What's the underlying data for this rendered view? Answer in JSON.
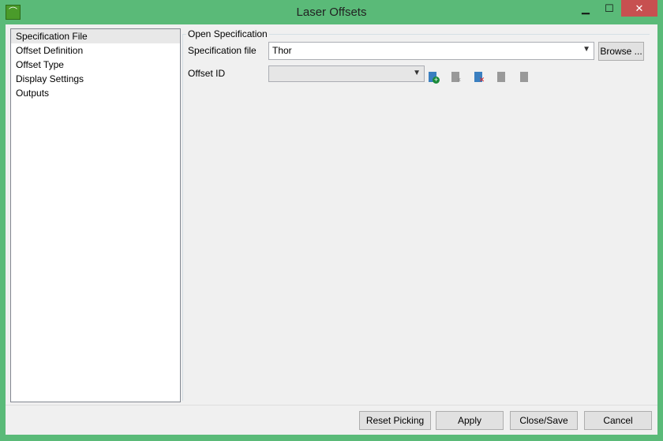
{
  "window": {
    "title": "Laser Offsets",
    "minimize": "▁",
    "maximize": "☐",
    "close": "✕"
  },
  "tree": [
    "Specification File",
    "Offset Definition",
    "Offset Type",
    "Display Settings",
    "Outputs"
  ],
  "group": {
    "title": "Open Specification",
    "spec_label": "Specification file",
    "spec_value": "Thor",
    "browse": "Browse ...",
    "offset_label": "Offset ID",
    "offset_value": ""
  },
  "footer": {
    "reset": "Reset Picking",
    "apply": "Apply",
    "close_save": "Close/Save",
    "cancel": "Cancel"
  }
}
